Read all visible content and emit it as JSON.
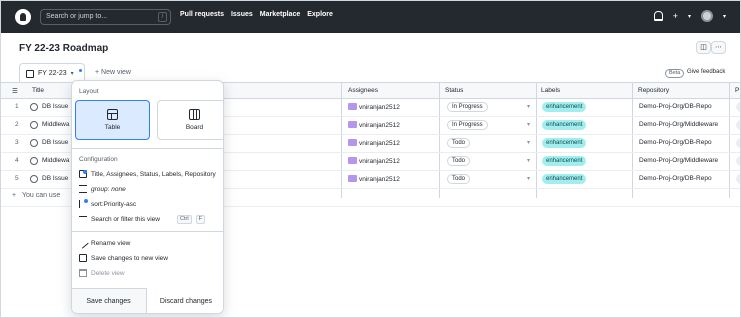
{
  "header": {
    "search_placeholder": "Search or jump to...",
    "search_shortcut": "/",
    "nav": [
      "Pull requests",
      "Issues",
      "Marketplace",
      "Explore"
    ],
    "plus_label": "+"
  },
  "project": {
    "title": "FY 22-23 Roadmap"
  },
  "tabs": {
    "active_label": "FY 22-23",
    "new_view_label": "+ New view",
    "beta_label": "Beta",
    "feedback_label": "Give feedback"
  },
  "table": {
    "columns": [
      "Title",
      "Assignees",
      "Status",
      "Labels",
      "Repository",
      "P"
    ],
    "rows": [
      {
        "num": "1",
        "title": "DB Issue",
        "assignee": "vniranjan2512",
        "status": "In Progress",
        "label": "enhancement",
        "repo": "Demo-Proj-Org/DB-Repo"
      },
      {
        "num": "2",
        "title": "Middlewa",
        "assignee": "vniranjan2512",
        "status": "In Progress",
        "label": "enhancement",
        "repo": "Demo-Proj-Org/Middleware"
      },
      {
        "num": "3",
        "title": "DB Issue",
        "assignee": "vniranjan2512",
        "status": "Todo",
        "label": "enhancement",
        "repo": "Demo-Proj-Org/DB-Repo"
      },
      {
        "num": "4",
        "title": "Middlewa",
        "assignee": "vniranjan2512",
        "status": "Todo",
        "label": "enhancement",
        "repo": "Demo-Proj-Org/Middleware"
      },
      {
        "num": "5",
        "title": "DB Issue",
        "assignee": "vniranjan2512",
        "status": "Todo",
        "label": "enhancement",
        "repo": "Demo-Proj-Org/DB-Repo"
      }
    ],
    "add_row_label": "You can use"
  },
  "menu": {
    "layout_heading": "Layout",
    "layout_table": "Table",
    "layout_board": "Board",
    "config_heading": "Configuration",
    "fields": "Title, Assignees, Status, Labels, Repository",
    "group": "group: none",
    "sort": "sort:Priority-asc",
    "filter": "Search or filter this view",
    "filter_kbd1": "Ctrl",
    "filter_kbd2": "F",
    "rename": "Rename view",
    "save_new": "Save changes to new view",
    "delete": "Delete view",
    "save_changes": "Save changes",
    "discard_changes": "Discard changes"
  },
  "colors": {
    "header_bg": "#24292f",
    "accent": "#2f81f7",
    "label_bg": "#a2eeef"
  }
}
